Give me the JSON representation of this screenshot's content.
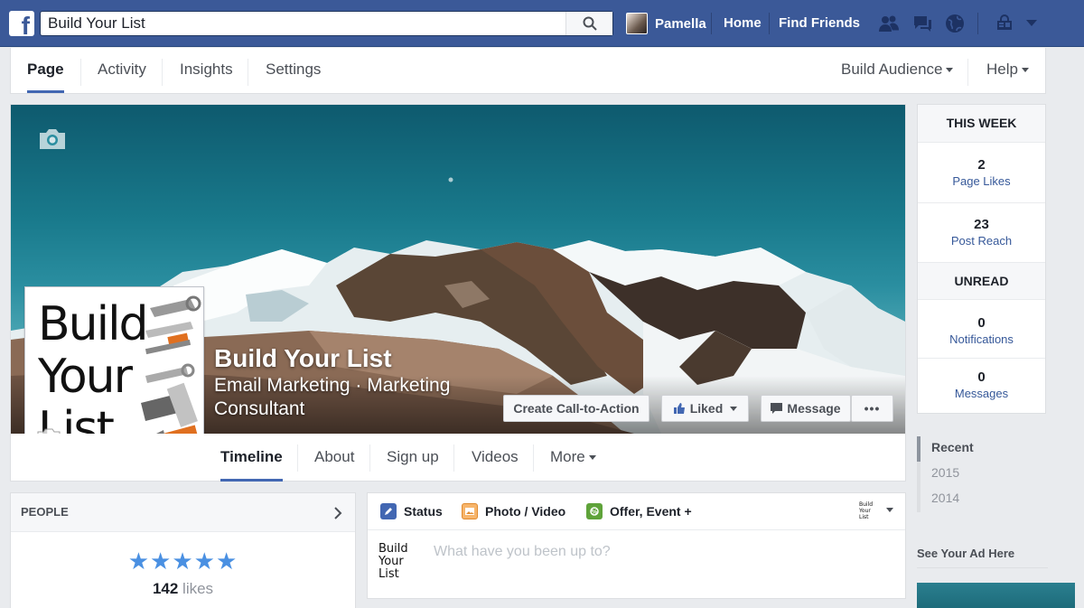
{
  "topbar": {
    "logo": "f",
    "search_value": "Build Your List",
    "user_name": "Pamella",
    "home": "Home",
    "find_friends": "Find Friends"
  },
  "page_tabs": {
    "page": "Page",
    "activity": "Activity",
    "insights": "Insights",
    "settings": "Settings",
    "build_audience": "Build Audience",
    "help": "Help"
  },
  "cover": {
    "profile_logo_lines": [
      "Build",
      "Your",
      "List"
    ],
    "page_name": "Build Your List",
    "category": "Email Marketing · Marketing Consultant",
    "create_cta": "Create Call-to-Action",
    "liked": "Liked",
    "message": "Message",
    "more_dots": "•••"
  },
  "cover_tabs": {
    "timeline": "Timeline",
    "about": "About",
    "signup": "Sign up",
    "videos": "Videos",
    "more": "More"
  },
  "this_week": {
    "title": "THIS WEEK",
    "page_likes_value": "2",
    "page_likes_label": "Page Likes",
    "post_reach_value": "23",
    "post_reach_label": "Post Reach",
    "unread_title": "UNREAD",
    "notifications_value": "0",
    "notifications_label": "Notifications",
    "messages_value": "0",
    "messages_label": "Messages"
  },
  "years": [
    "Recent",
    "2015",
    "2014"
  ],
  "ads": {
    "see_your_ad": "See Your Ad Here"
  },
  "people": {
    "title": "PEOPLE",
    "stars": "★★★★★",
    "likes_count": "142",
    "likes_label": "likes"
  },
  "composer": {
    "status": "Status",
    "photo_video": "Photo / Video",
    "offer_event": "Offer, Event +",
    "placeholder": "What have you been up to?"
  },
  "colors": {
    "fb_blue": "#3b5998",
    "link": "#365899",
    "star": "#4a90e2"
  }
}
